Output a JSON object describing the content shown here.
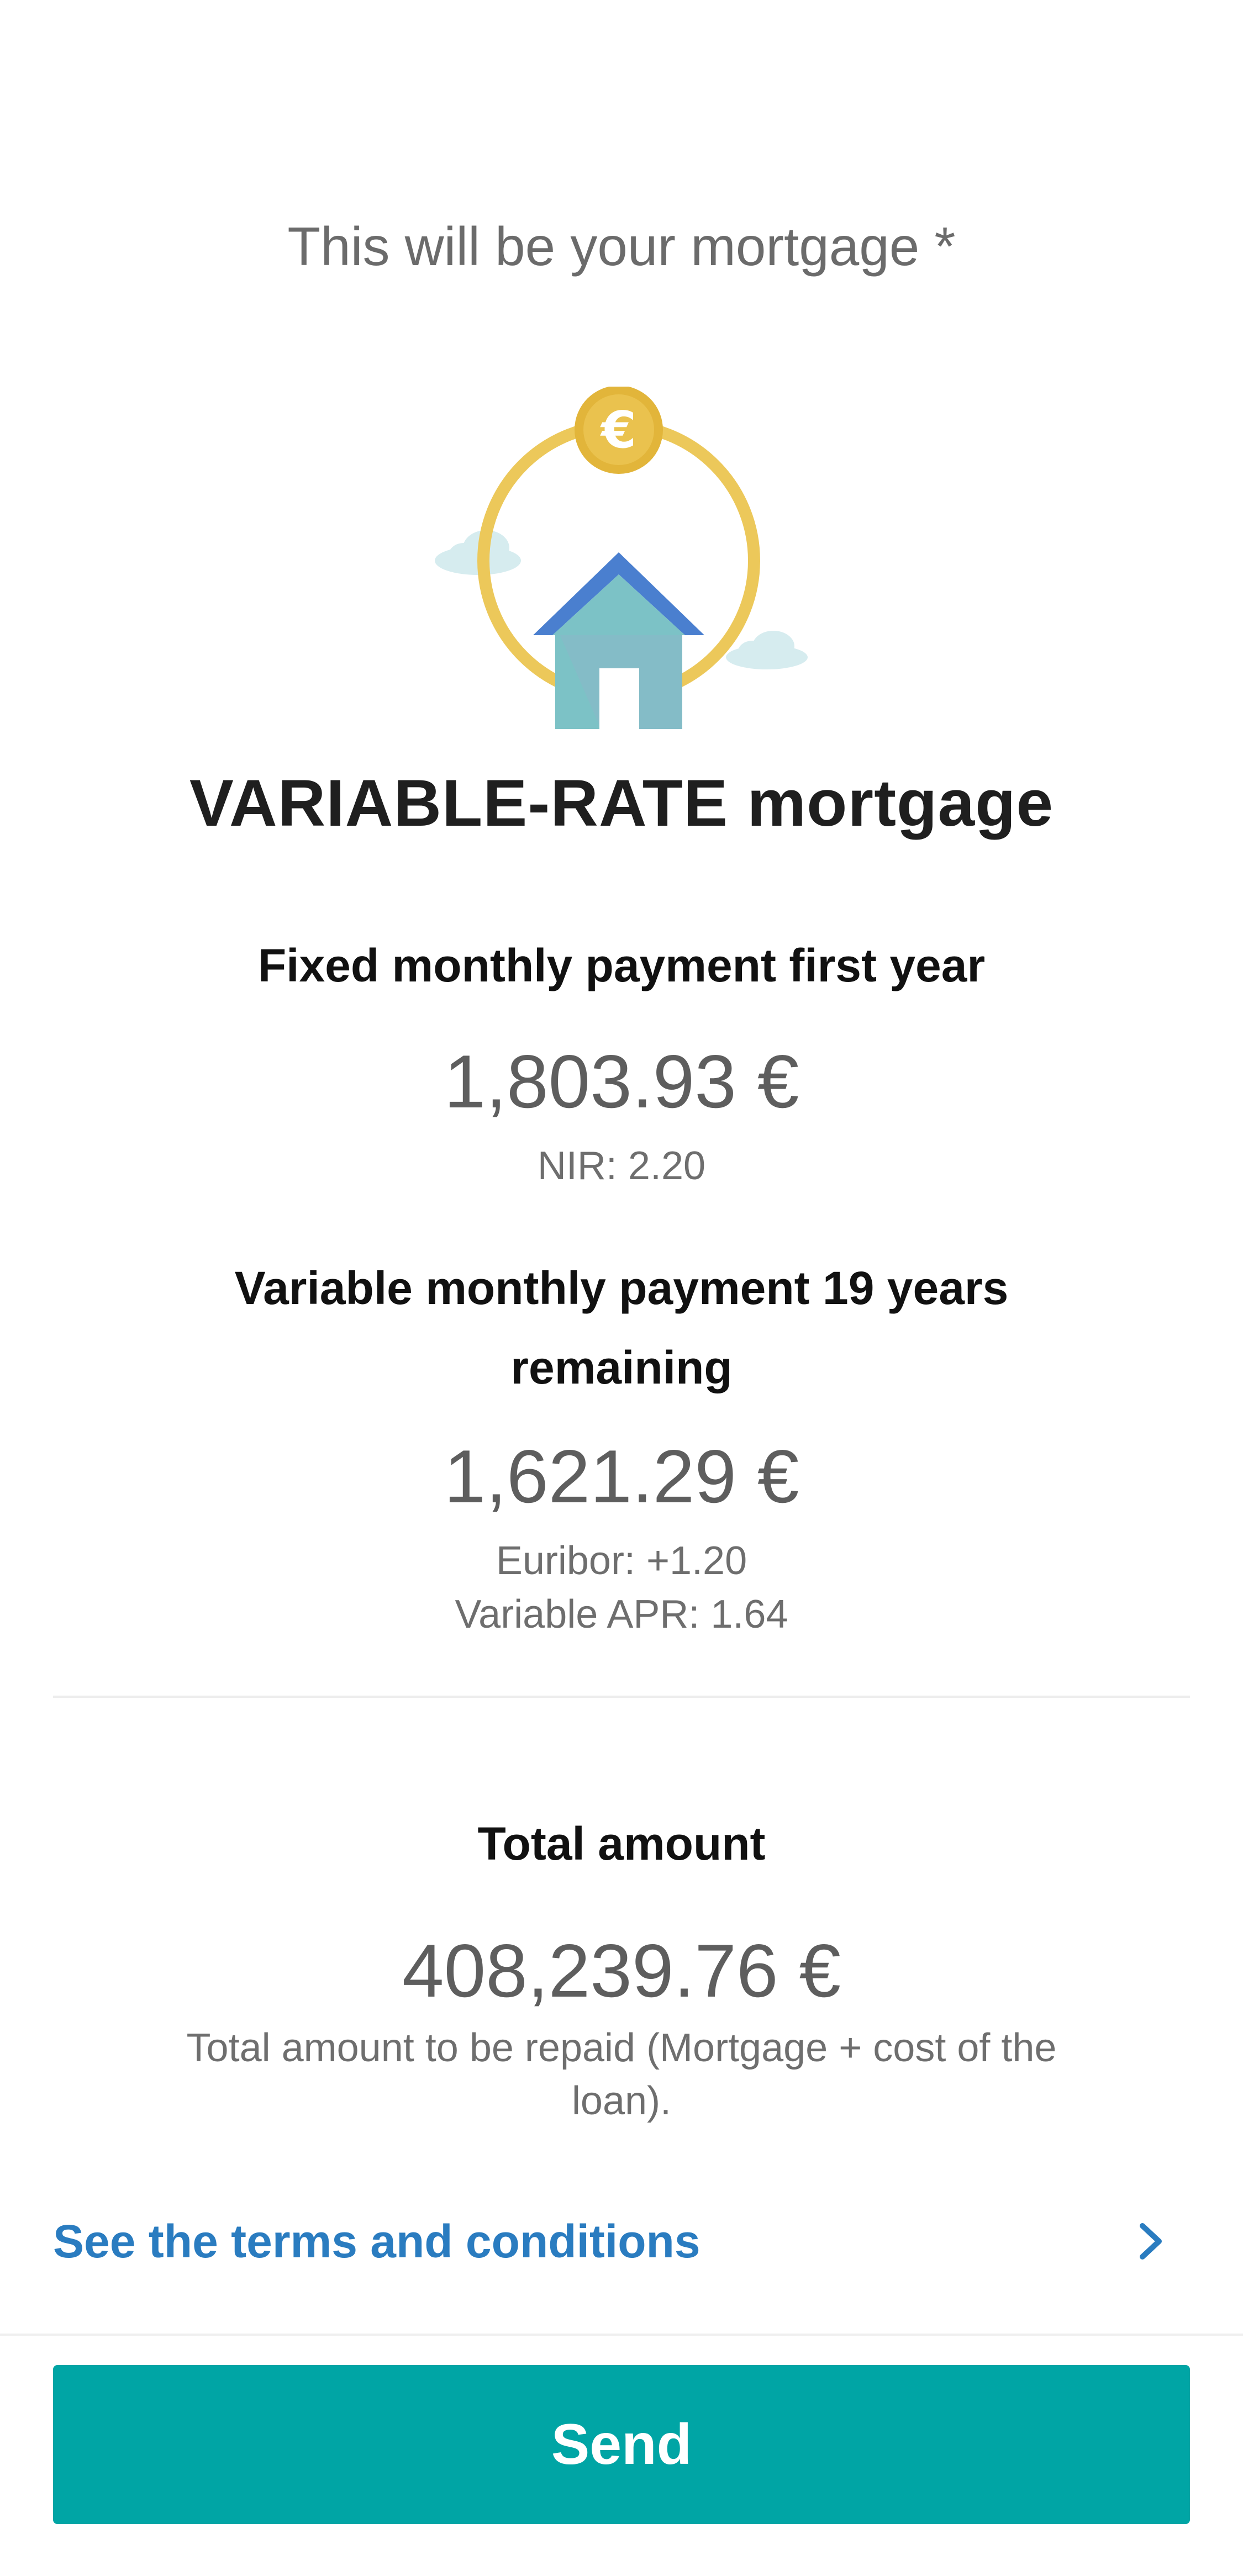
{
  "header": {
    "subtitle": "This will be your mortgage *"
  },
  "illustration": {
    "coin_symbol": "€",
    "icon_name": "house-coin-icon",
    "colors": {
      "ring": "#ecc85a",
      "coin": "#e2b53a",
      "roof": "#4a7fcf",
      "house_body": "#7cc2c6",
      "door": "#ffffff",
      "cloud": "#d6ecef"
    }
  },
  "product": {
    "title": "VARIABLE-RATE mortgage"
  },
  "fixed_section": {
    "heading": "Fixed monthly payment first year",
    "amount": "1,803.93 €",
    "nir": "NIR: 2.20"
  },
  "variable_section": {
    "heading": "Variable monthly payment 19 years remaining",
    "amount": "1,621.29 €",
    "euribor": "Euribor: +1.20",
    "apr": "Variable APR: 1.64"
  },
  "total_section": {
    "heading": "Total amount",
    "amount": "408,239.76 €",
    "description": "Total amount to be repaid (Mortgage + cost of the loan)."
  },
  "terms": {
    "label": "See the terms and conditions",
    "icon": "chevron-right-icon"
  },
  "actions": {
    "send_label": "Send"
  },
  "theme": {
    "accent": "#00a5a5",
    "link": "#2a7cc0"
  }
}
